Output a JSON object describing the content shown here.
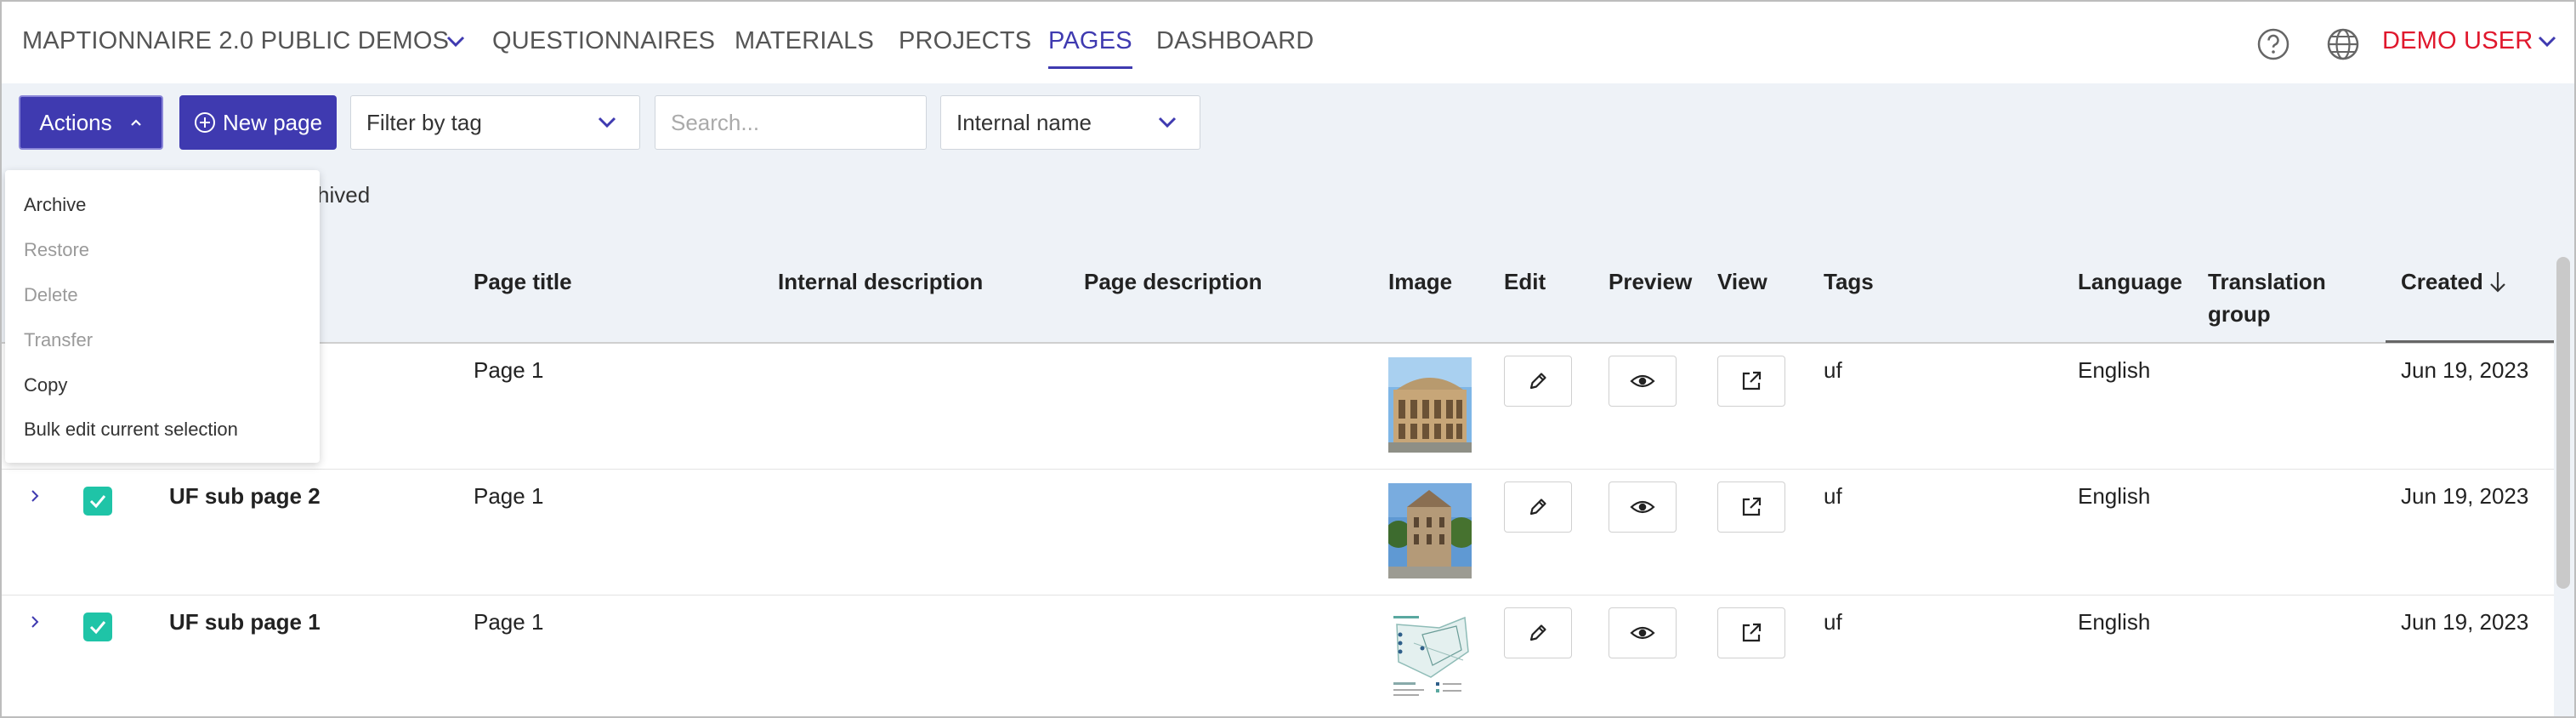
{
  "nav": {
    "org": "MAPTIONNAIRE 2.0 PUBLIC DEMOS",
    "items": [
      "QUESTIONNAIRES",
      "MATERIALS",
      "PROJECTS",
      "PAGES",
      "DASHBOARD"
    ],
    "active": "PAGES",
    "user": "DEMO USER"
  },
  "colors": {
    "primary": "#3f3ab0",
    "user": "#e0182d",
    "check": "#1fc4a7",
    "bg": "#eef2f7"
  },
  "toolbar": {
    "actions_label": "Actions",
    "new_page_label": "New page",
    "filter_tag_label": "Filter by tag",
    "search_placeholder": "Search...",
    "sort_label": "Internal name"
  },
  "partial_text": "chived",
  "actions_menu": {
    "archive": "Archive",
    "restore": "Restore",
    "delete": "Delete",
    "transfer": "Transfer",
    "copy": "Copy",
    "bulk_edit": "Bulk edit current selection"
  },
  "table": {
    "headers": {
      "page_title": "Page title",
      "internal_description": "Internal description",
      "page_description": "Page description",
      "image": "Image",
      "edit": "Edit",
      "preview": "Preview",
      "view": "View",
      "tags": "Tags",
      "language": "Language",
      "translation_group_1": "Translation",
      "translation_group_2": "group",
      "created": "Created"
    },
    "rows": [
      {
        "name": "",
        "page_title": "Page 1",
        "tags": "uf",
        "language": "English",
        "created": "Jun 19, 2023",
        "image": "opera-house-photo"
      },
      {
        "name": "UF sub page 2",
        "page_title": "Page 1",
        "tags": "uf",
        "language": "English",
        "created": "Jun 19, 2023",
        "image": "castle-photo"
      },
      {
        "name": "UF sub page 1",
        "page_title": "Page 1",
        "tags": "uf",
        "language": "English",
        "created": "Jun 19, 2023",
        "image": "map-diagram"
      }
    ]
  }
}
